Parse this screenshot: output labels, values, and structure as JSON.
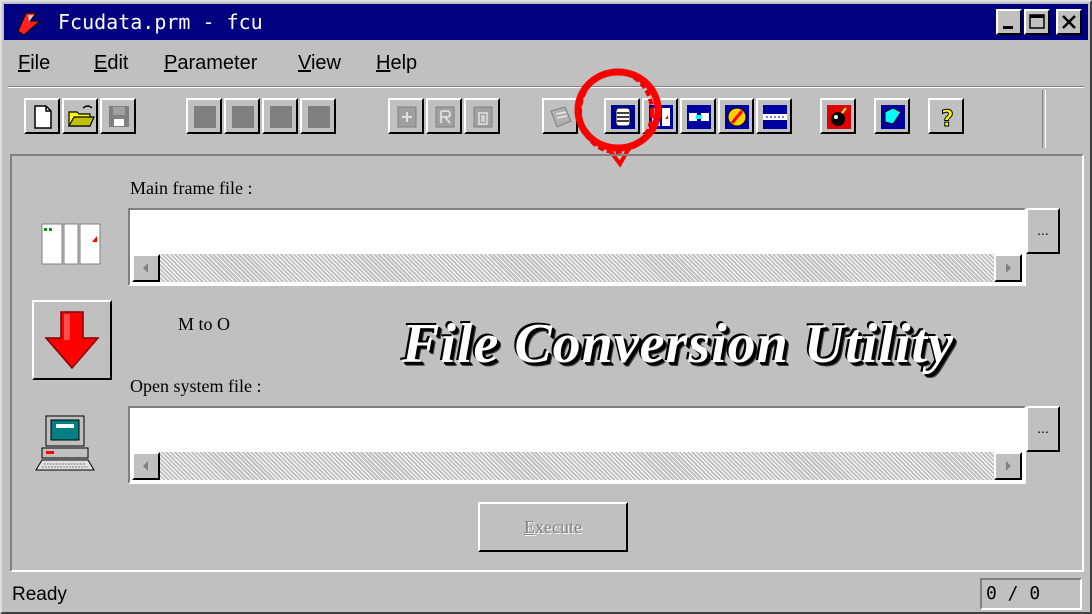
{
  "window": {
    "title": "Fcudata.prm - fcu",
    "app_icon": "fcu-app-icon",
    "caption_buttons": [
      "minimize-icon",
      "maximize-icon",
      "close-icon"
    ]
  },
  "menu": [
    {
      "label": "File",
      "mnemonic": "F",
      "rest": "ile"
    },
    {
      "label": "Edit",
      "mnemonic": "E",
      "rest": "dit"
    },
    {
      "label": "Parameter",
      "mnemonic": "P",
      "rest": "arameter"
    },
    {
      "label": "View",
      "mnemonic": "V",
      "rest": "iew"
    },
    {
      "label": "Help",
      "mnemonic": "H",
      "rest": "elp"
    }
  ],
  "toolbar": {
    "buttons": [
      {
        "icon": "new-file-icon",
        "enabled": true
      },
      {
        "icon": "open-folder-icon",
        "enabled": true
      },
      {
        "icon": "save-icon",
        "enabled": false
      },
      {
        "icon": "blank-icon",
        "enabled": false
      },
      {
        "icon": "blank-icon",
        "enabled": false
      },
      {
        "icon": "blank-icon",
        "enabled": false
      },
      {
        "icon": "blank-icon",
        "enabled": false
      },
      {
        "icon": "add-record-icon",
        "enabled": false
      },
      {
        "icon": "record-icon",
        "enabled": false
      },
      {
        "icon": "delete-icon",
        "enabled": false
      },
      {
        "icon": "transfer-icon",
        "enabled": false
      },
      {
        "icon": "database-list-icon",
        "enabled": true,
        "highlighted": true
      },
      {
        "icon": "frame-icon",
        "enabled": true
      },
      {
        "icon": "connector-icon",
        "enabled": true
      },
      {
        "icon": "edit-pencil-icon",
        "enabled": true
      },
      {
        "icon": "lines-icon",
        "enabled": true
      },
      {
        "icon": "bomb-icon",
        "enabled": true
      },
      {
        "icon": "note-edit-icon",
        "enabled": true
      },
      {
        "icon": "help-icon",
        "enabled": true
      }
    ],
    "highlight_color": "#ff0000"
  },
  "main": {
    "main_frame_label": "Main frame file :",
    "main_frame_value": "",
    "direction_label": "M to O",
    "banner": "File Conversion Utility",
    "open_system_label": "Open system file :",
    "open_system_value": "",
    "browse_label": "...",
    "execute_label": "Execute",
    "execute_mnemonic": "E",
    "execute_rest": "xecute",
    "execute_enabled": false
  },
  "status": {
    "text": "Ready",
    "counter": "0 / 0"
  },
  "colors": {
    "titlebar": "#000080",
    "face": "#c0c0c0",
    "arrow": "#ff0000"
  }
}
